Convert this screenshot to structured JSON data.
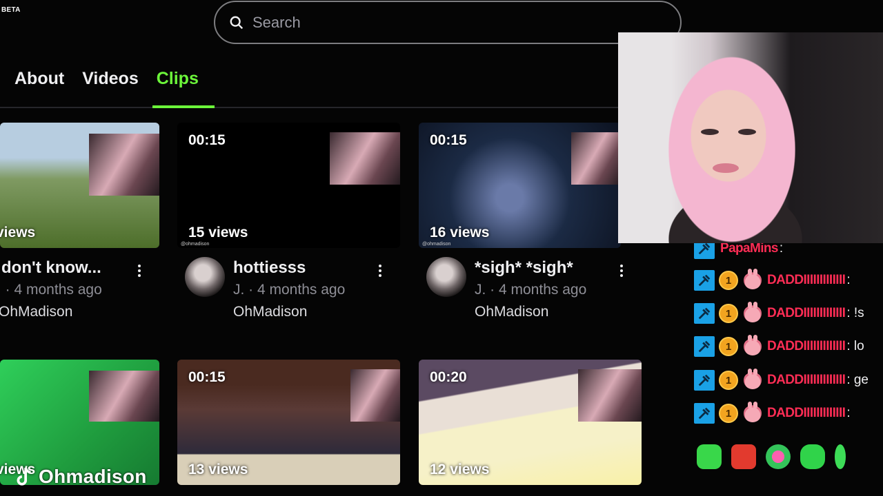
{
  "header": {
    "beta_label": "BETA"
  },
  "search": {
    "placeholder": "Search"
  },
  "tabs": [
    {
      "label": "About",
      "active": false
    },
    {
      "label": "Videos",
      "active": false
    },
    {
      "label": "Clips",
      "active": true
    }
  ],
  "clips": [
    {
      "duration": "",
      "views": "views",
      "title": "don't know...",
      "meta": ". · 4 months ago",
      "channel": "OhMadison"
    },
    {
      "duration": "00:15",
      "views": "15 views",
      "title": "hottiesss",
      "meta": "J. · 4 months ago",
      "channel": "OhMadison",
      "watermark": "@ohmadison"
    },
    {
      "duration": "00:15",
      "views": "16 views",
      "title": "*sigh* *sigh*",
      "meta": "J. · 4 months ago",
      "channel": "OhMadison",
      "watermark": "@ohmadison"
    },
    {
      "duration": "",
      "views": "views"
    },
    {
      "duration": "00:15",
      "views": "13 views"
    },
    {
      "duration": "00:20",
      "views": "12 views"
    }
  ],
  "chat": {
    "messages": [
      {
        "user": "PapaMins",
        "text": ":"
      },
      {
        "user": "DADDIIIIIIIIIIIII",
        "text": ":"
      },
      {
        "user": "DADDIIIIIIIIIIIII",
        "text": ": !s"
      },
      {
        "user": "DADDIIIIIIIIIIIII",
        "text": ": lo"
      },
      {
        "user": "DADDIIIIIIIIIIIII",
        "text": ": ge"
      },
      {
        "user": "DADDIIIIIIIIIIIII",
        "text": ":"
      }
    ],
    "coin_badge": "1"
  },
  "watermark": {
    "handle": "Ohmadison"
  },
  "colors": {
    "accent": "#6cf63a",
    "chat_user": "#ff2d55",
    "mod_badge": "#1aa1e6"
  }
}
